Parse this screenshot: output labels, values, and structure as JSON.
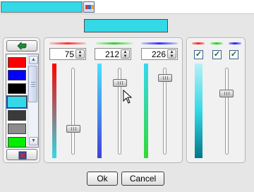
{
  "colors": {
    "cyan": "#33d9e6",
    "red": "#ff0000",
    "blue": "#0000ff",
    "black": "#000000",
    "white": "#ffffff",
    "gray": "#555555",
    "lightgray": "#8c8c8c",
    "green": "#00ff00"
  },
  "launcher": {
    "color": "#33d9e6",
    "icon": "color-picker-icon"
  },
  "preview": {
    "color": "#33d9e6"
  },
  "palette": {
    "add_icon": "add-color-arrow-icon",
    "delete_icon": "delete-color-icon",
    "swatches": [
      {
        "color": "#ff0000",
        "selected": false
      },
      {
        "color": "#0000ff",
        "selected": false
      },
      {
        "color": "#000000",
        "selected": false
      },
      {
        "color": "#33d9e6",
        "selected": true
      },
      {
        "color": "#3a3a3a",
        "selected": false
      },
      {
        "color": "#8c8c8c",
        "selected": false
      },
      {
        "color": "#00ee00",
        "selected": false
      }
    ]
  },
  "channels": [
    {
      "name": "red",
      "value": "75",
      "level": 0.294,
      "header_color": "#ff4040"
    },
    {
      "name": "green",
      "value": "212",
      "level": 0.831,
      "header_color": "#40d040"
    },
    {
      "name": "blue",
      "value": "226",
      "level": 0.886,
      "header_color": "#4040ff"
    }
  ],
  "alpha": {
    "checks": [
      true,
      true,
      true
    ],
    "level": 0.62
  },
  "buttons": {
    "ok": "Ok",
    "cancel": "Cancel"
  }
}
